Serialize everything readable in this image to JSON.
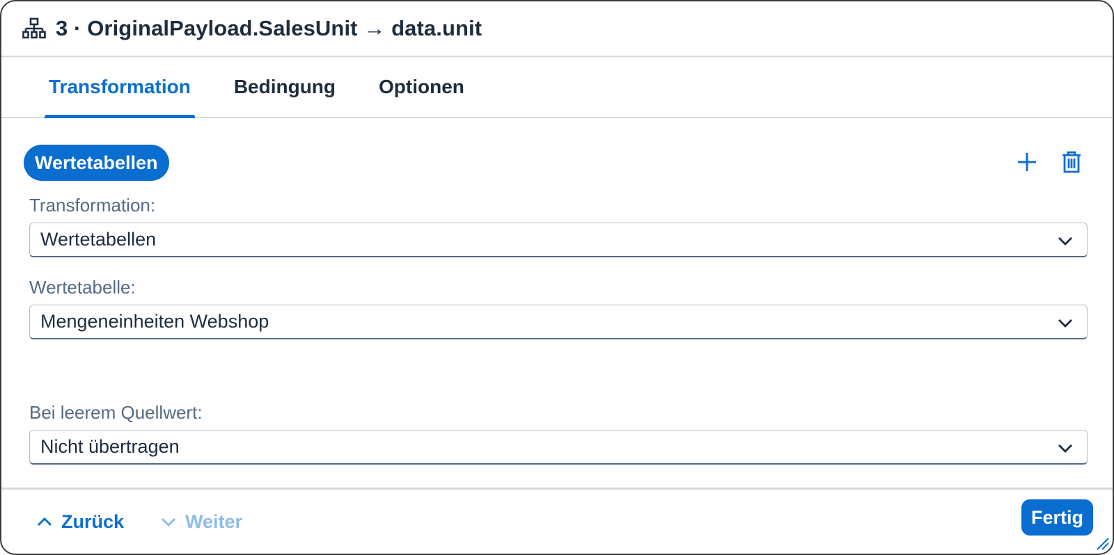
{
  "header": {
    "title": "3 · OriginalPayload.SalesUnit → data.unit",
    "icon": "hierarchy-icon"
  },
  "tabs": [
    {
      "label": "Transformation",
      "active": true
    },
    {
      "label": "Bedingung",
      "active": false
    },
    {
      "label": "Optionen",
      "active": false
    }
  ],
  "content": {
    "chip_label": "Wertetabellen",
    "add_icon": "add-icon",
    "delete_icon": "delete-icon",
    "fields": [
      {
        "label": "Transformation:",
        "value": "Wertetabellen"
      },
      {
        "label": "Wertetabelle:",
        "value": "Mengeneinheiten Webshop"
      },
      {
        "label": "Bei leerem Quellwert:",
        "value": "Nicht übertragen"
      }
    ]
  },
  "footer": {
    "back_label": "Zurück",
    "next_label": "Weiter",
    "done_label": "Fertig"
  },
  "colors": {
    "accent": "#0a6ed1",
    "text": "#1d2d3e",
    "label": "#556b82",
    "disabled": "#8fbce8"
  }
}
